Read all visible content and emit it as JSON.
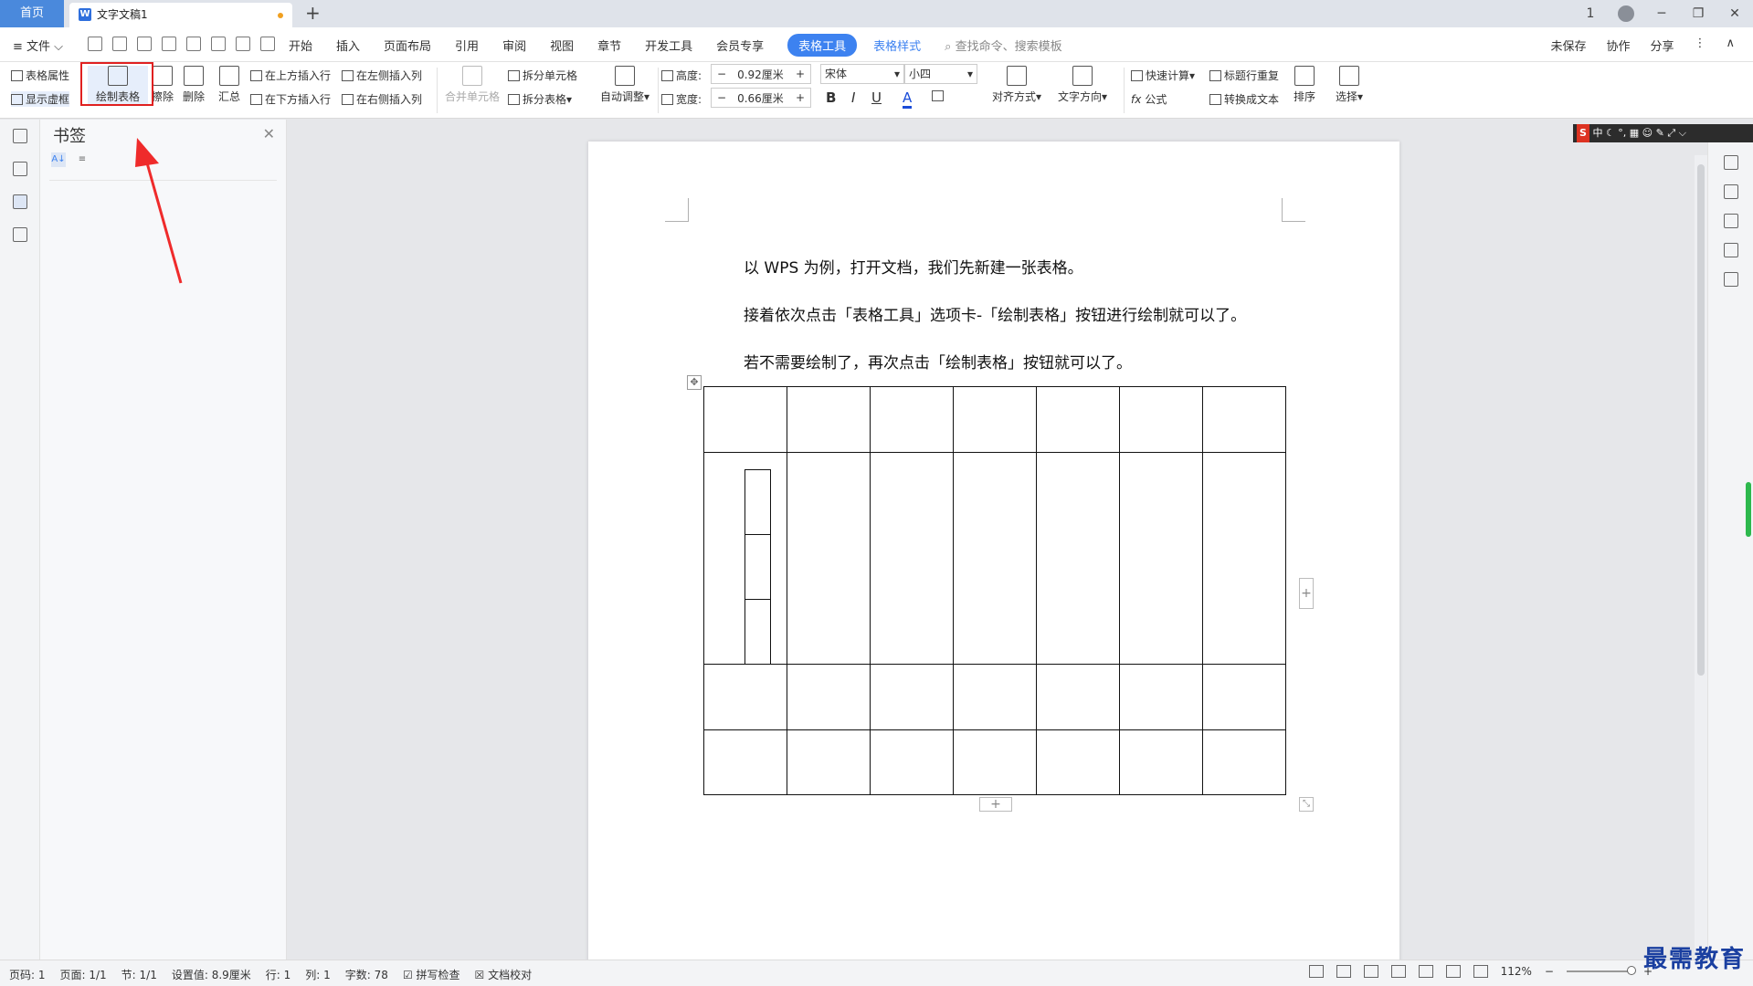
{
  "titlebar": {
    "home_tab": "首页",
    "doc_icon_letter": "W",
    "doc_tab": "文字文稿1",
    "new_tab": "+",
    "page_counter": "1",
    "win_min": "─",
    "win_max": "❐",
    "win_close": "✕"
  },
  "menubar": {
    "file": "≡ 文件 ⌵",
    "tabs": [
      "开始",
      "插入",
      "页面布局",
      "引用",
      "审阅",
      "视图",
      "章节",
      "开发工具",
      "会员专享"
    ],
    "active_tab": "表格工具",
    "style_tab": "表格样式",
    "search": "查找命令、搜索模板",
    "unsaved": "未保存",
    "collab": "协作",
    "share": "分享",
    "more": "⋮",
    "collapse": "∧"
  },
  "ribbon": {
    "table_props": "表格属性",
    "show_gridlines": "显示虚框",
    "draw_table": "绘制表格",
    "erase": "擦除",
    "delete": "删除",
    "summary": "汇总",
    "insert_above": "在上方插入行",
    "insert_below": "在下方插入行",
    "insert_left": "在左侧插入列",
    "insert_right": "在右侧插入列",
    "merge_cells": "合并单元格",
    "split_cells": "拆分单元格",
    "split_table": "拆分表格",
    "auto_fit": "自动调整",
    "height_label": "高度:",
    "height_value": "0.92厘米",
    "width_label": "宽度:",
    "width_value": "0.66厘米",
    "font_name": "宋体",
    "font_size": "小四",
    "bold": "B",
    "italic": "I",
    "underline": "U",
    "font_color": "A",
    "align": "对齐方式",
    "text_direction": "文字方向",
    "quick_calc": "快速计算",
    "formula": "公式",
    "header_repeat": "标题行重复",
    "to_text": "转换成文本",
    "sort": "排序",
    "select": "选择",
    "spin_minus": "−",
    "spin_plus": "+",
    "dropdown_caret": "▾"
  },
  "panel": {
    "title": "书签",
    "close": "✕",
    "sort_az": "A↓",
    "sort_pos": "≡"
  },
  "document": {
    "paragraphs": [
      "以 WPS 为例，打开文档，我们先新建一张表格。",
      "接着依次点击「表格工具」选项卡-「绘制表格」按钮进行绘制就可以了。",
      "若不需要绘制了，再次点击「绘制表格」按钮就可以了。"
    ],
    "move_handle": "✥",
    "add_col": "+",
    "add_row": "+",
    "resize": "⤡"
  },
  "ime": {
    "s": "S",
    "lang": "中"
  },
  "statusbar": {
    "page_code": "页码: 1",
    "page": "页面: 1/1",
    "section": "节: 1/1",
    "setting": "设置值: 8.9厘米",
    "row": "行: 1",
    "col": "列: 1",
    "word_count": "字数: 78",
    "spell_check": "拼写检查",
    "doc_check": "文档校对",
    "zoom": "112%",
    "zoom_out": "−",
    "zoom_in": "+"
  },
  "watermark": "最需教育",
  "colors": {
    "accent": "#3d82f0",
    "highlight": "#e02020",
    "home_tab": "#4a89dc"
  }
}
